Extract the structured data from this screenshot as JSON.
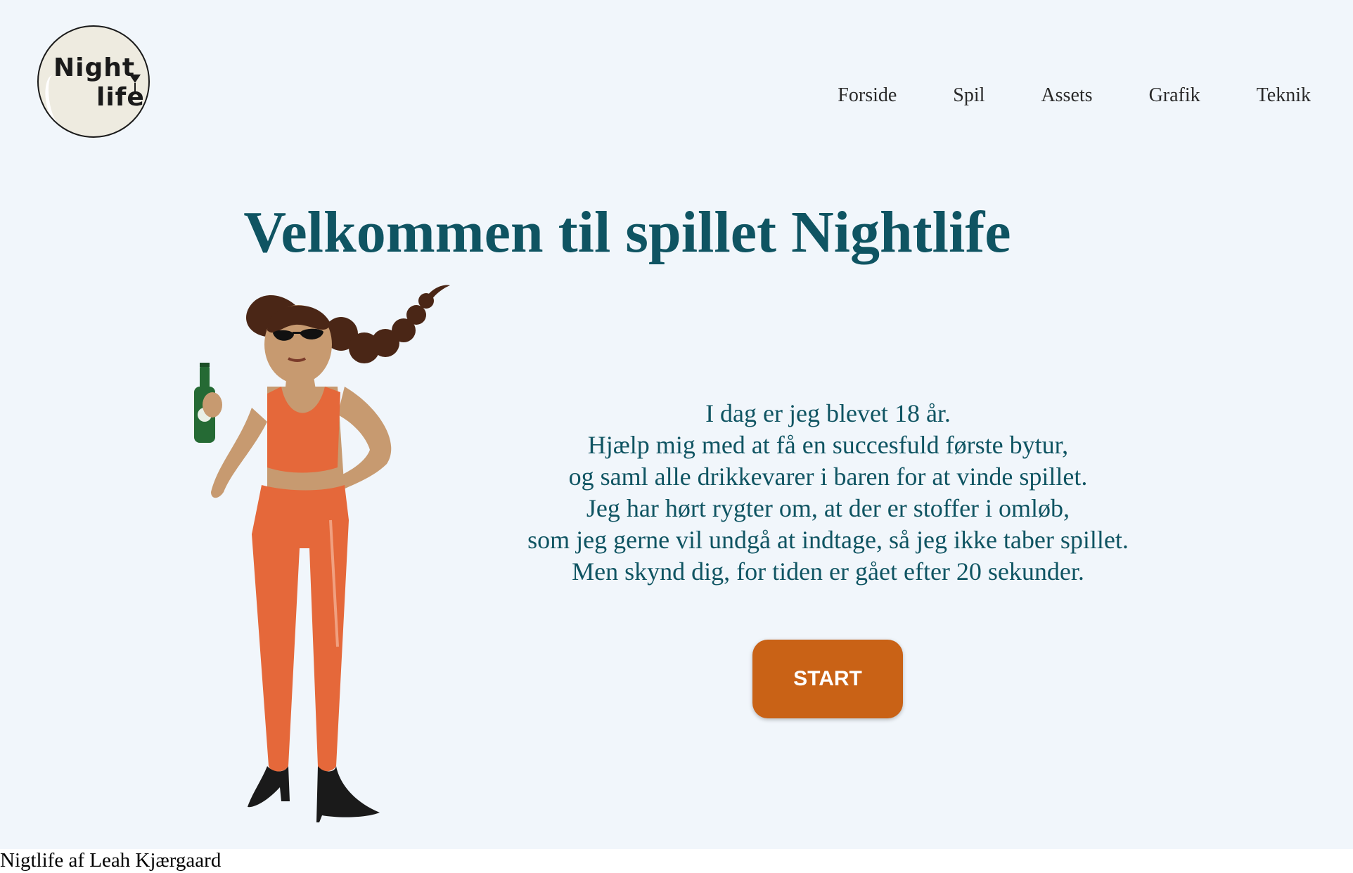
{
  "header": {
    "logo": {
      "line1": "Night",
      "line2": "life"
    },
    "nav": [
      {
        "label": "Forside"
      },
      {
        "label": "Spil"
      },
      {
        "label": "Assets"
      },
      {
        "label": "Grafik"
      },
      {
        "label": "Teknik"
      }
    ]
  },
  "main": {
    "title": "Velkommen til spillet Nightlife",
    "intro_lines": [
      "I dag er jeg blevet 18 år.",
      "Hjælp mig med at få en succesfuld første bytur,",
      "og saml alle drikkevarer i baren for at vinde spillet.",
      "Jeg har hørt rygter om, at der er stoffer i omløb,",
      "som jeg gerne vil undgå at indtage, så jeg ikke taber spillet.",
      "Men skynd dig, for tiden er gået efter 20 sekunder."
    ],
    "start_button": "START",
    "illustration": "woman-with-beer-bottle-illustration"
  },
  "footer": {
    "text": "Nigtlife af Leah Kjærgaard"
  },
  "colors": {
    "background": "#f1f6fb",
    "title": "#0f5462",
    "button": "#c96216",
    "button_text": "#ffffff",
    "outfit": "#e5683a"
  }
}
